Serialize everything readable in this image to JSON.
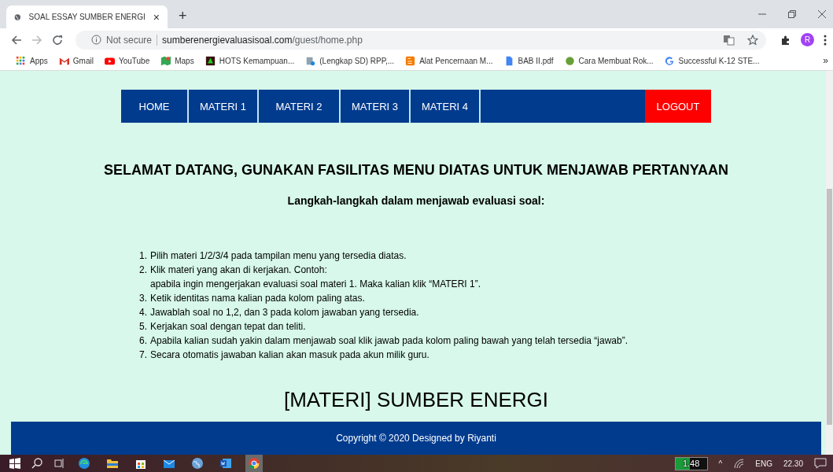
{
  "browser": {
    "tab_title": "SOAL ESSAY SUMBER ENERGI",
    "tab_close": "×",
    "new_tab": "+",
    "security": "Not secure",
    "url_domain": "sumberenergievaluasisoal.com",
    "url_path": "/guest/home.php",
    "profile_initial": "R",
    "bookmarks": [
      "Apps",
      "Gmail",
      "YouTube",
      "Maps",
      "HOTS Kemampuan...",
      "(Lengkap SD) RPP,...",
      "Alat Pencernaan M...",
      "BAB II.pdf",
      "Cara Membuat Rok...",
      "Successful K-12 STE..."
    ],
    "more": "»"
  },
  "nav": [
    {
      "label": "HOME",
      "kind": "menu"
    },
    {
      "label": "MATERI 1",
      "kind": "menu"
    },
    {
      "label": "MATERI 2",
      "kind": "menu"
    },
    {
      "label": "MATERI 3",
      "kind": "menu"
    },
    {
      "label": "MATERI 4",
      "kind": "menu"
    },
    {
      "label": "LOGOUT",
      "kind": "logout"
    }
  ],
  "heading": "SELAMAT DATANG, GUNAKAN FASILITAS MENU DIATAS UNTUK MENJAWAB PERTANYAAN",
  "subheading": "Langkah-langkah dalam menjawab evaluasi soal:",
  "steps": [
    {
      "number": "1.",
      "lines": [
        "Pilih materi 1/2/3/4 pada tampilan menu yang tersedia diatas."
      ]
    },
    {
      "number": "2.",
      "lines": [
        "Klik materi yang akan di kerjakan. Contoh:",
        "apabila ingin mengerjakan evaluasi soal materi 1. Maka kalian klik “MATERI 1”."
      ]
    },
    {
      "number": "3.",
      "lines": [
        "Ketik identitas nama kalian pada kolom paling atas."
      ]
    },
    {
      "number": "4.",
      "lines": [
        "Jawablah soal no 1,2, dan 3 pada kolom jawaban yang tersedia."
      ]
    },
    {
      "number": "5.",
      "lines": [
        "Kerjakan soal dengan tepat dan teliti."
      ]
    },
    {
      "number": "6.",
      "lines": [
        "Apabila kalian sudah yakin dalam menjawab soal klik jawab pada kolom paling bawah yang telah tersedia “jawab”."
      ]
    },
    {
      "number": "7.",
      "lines": [
        "Secara otomatis jawaban kalian akan masuk pada akun milik guru."
      ]
    }
  ],
  "section_title": "[MATERI] SUMBER ENERGI",
  "footer": "Copyright © 2020 Designed by Riyanti",
  "taskbar": {
    "apps": [
      {
        "active": false
      },
      {
        "active": false
      },
      {
        "active": false
      },
      {
        "active": false
      },
      {
        "active": false
      },
      {
        "active": false
      },
      {
        "active": true
      }
    ],
    "battery": {
      "reading": "1.48",
      "level": 0.45
    },
    "chevron": "^",
    "language": "ENG",
    "time": "22.30"
  }
}
